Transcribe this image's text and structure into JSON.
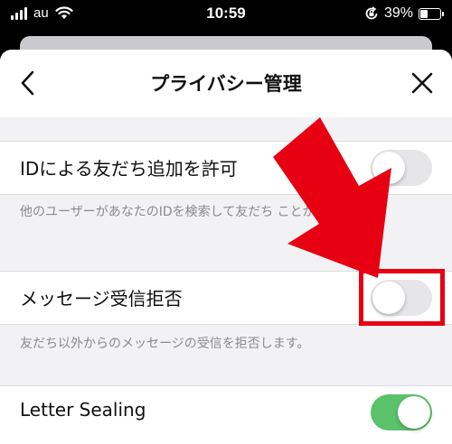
{
  "status_bar": {
    "carrier": "au",
    "time": "10:59",
    "battery_percent_text": "39%",
    "battery_level": 0.39
  },
  "navbar": {
    "title": "プライバシー管理",
    "back_icon": "chevron-left-icon",
    "close_icon": "close-icon"
  },
  "settings": [
    {
      "label": "IDによる友だち追加を許可",
      "description": "他のユーザーがあなたのIDを検索して友だち      ことができます。",
      "enabled": false
    },
    {
      "label": "メッセージ受信拒否",
      "description": "友だち以外からのメッセージの受信を拒否します。",
      "enabled": false
    },
    {
      "label": "Letter Sealing",
      "enabled": true
    }
  ],
  "colors": {
    "annotation_red": "#e60012",
    "toggle_on": "#5ac26a",
    "toggle_off": "#e6e6e9"
  }
}
